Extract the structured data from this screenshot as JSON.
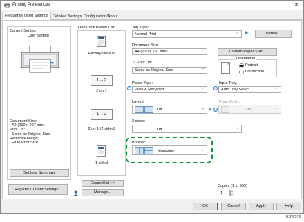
{
  "window": {
    "title": "Printing Preferences",
    "close_glyph": "✕"
  },
  "tabs": [
    {
      "label": "Frequently Used Settings",
      "active": true
    },
    {
      "label": "Detailed Settings",
      "active": false
    },
    {
      "label": "Configuration/About",
      "active": false
    }
  ],
  "left_panel": {
    "current_setting_label": "Current Setting",
    "user_setting_label": "User Setting",
    "summary": [
      "Document Size:",
      "A4 (210 x 297 mm)",
      "Print On:",
      "Same as Original Size",
      "Reduce/Enlarge:",
      "Fit to Print Size"
    ],
    "settings_summary_button": "Settings Summary",
    "register_button": "Register Current Settings..."
  },
  "presets": {
    "label": "One Click Preset List:",
    "items": [
      {
        "label": "Factory Default",
        "icon": "document-icon"
      },
      {
        "label": "2 on 1",
        "icon": "two-up-icon",
        "glyph": "1→2"
      },
      {
        "label": "2 on 1 (2 sided)",
        "icon": "two-up-duplex-icon",
        "glyph": "1→2"
      },
      {
        "label": "1 sided",
        "icon": "document-icon"
      }
    ],
    "expand_button": "Expand list >>",
    "manage_button": "Manage..."
  },
  "job_type": {
    "label": "Job Type:",
    "value": "Normal Print",
    "details_button": "Details..."
  },
  "document_size": {
    "label": "Document Size:",
    "value": "A4 (210 x 297 mm)",
    "custom_button": "Custom Paper Size..."
  },
  "print_on": {
    "label": "Print On:",
    "value": "Same as Original Size"
  },
  "orientation": {
    "label": "Orientation",
    "options": [
      "Portrait",
      "Landscape"
    ],
    "selected": "Portrait"
  },
  "paper_type": {
    "label": "Paper Type:",
    "value": "Plain & Recycled"
  },
  "input_tray": {
    "label": "Input Tray:",
    "value": "Auto Tray Select"
  },
  "layout": {
    "label": "Layout:",
    "value": "Off"
  },
  "page_order": {
    "label": "Page Order:",
    "value": "Off"
  },
  "two_sided": {
    "label": "2 sided:",
    "value": "Off"
  },
  "booklet": {
    "label": "Booklet:",
    "value": "Magazine"
  },
  "copies": {
    "label": "Copies:(1 to 999)",
    "value": "1"
  },
  "footer": {
    "ok": "OK",
    "cancel": "Cancel",
    "apply": "Apply",
    "help": "Help"
  },
  "caption": "EBW376",
  "colors": {
    "highlight": "#0a9a3c",
    "accent": "#1a6fd1"
  }
}
